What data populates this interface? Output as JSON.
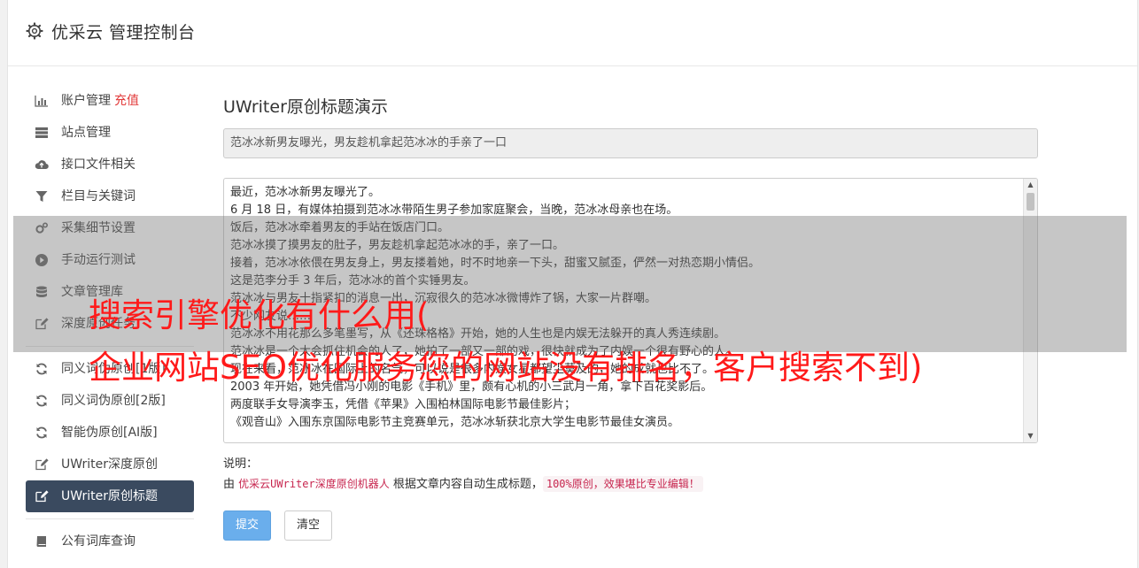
{
  "header": {
    "title": "优采云 管理控制台",
    "icon": "gear-icon"
  },
  "sidebar": {
    "items": [
      {
        "label": "账户管理",
        "accent": "充值",
        "icon": "bar-chart-icon"
      },
      {
        "label": "站点管理",
        "icon": "server-icon"
      },
      {
        "label": "接口文件相关",
        "icon": "cloud-upload-icon"
      },
      {
        "label": "栏目与关键词",
        "icon": "filter-icon"
      },
      {
        "label": "采集细节设置",
        "icon": "gears-icon"
      },
      {
        "label": "手动运行测试",
        "icon": "play-circle-icon"
      },
      {
        "label": "文章管理库",
        "icon": "database-icon"
      },
      {
        "label": "深度原创任务",
        "icon": "edit-icon"
      },
      {
        "label": "同义词伪原创[1版]",
        "icon": "refresh-icon"
      },
      {
        "label": "同义词伪原创[2版]",
        "icon": "refresh-icon"
      },
      {
        "label": "智能伪原创[AI版]",
        "icon": "refresh-icon"
      },
      {
        "label": "UWriter深度原创",
        "icon": "edit-icon"
      },
      {
        "label": "UWriter原创标题",
        "icon": "edit-icon",
        "active": true
      },
      {
        "label": "公有词库查询",
        "icon": "book-icon"
      }
    ]
  },
  "main": {
    "heading": "UWriter原创标题演示",
    "title_value": "范冰冰新男友曝光，男友趁机拿起范冰冰的手亲了一口",
    "content_lines": [
      "最近，范冰冰新男友曝光了。",
      "6 月 18 日，有媒体拍摄到范冰冰带陌生男子参加家庭聚会，当晚，范冰冰母亲也在场。",
      "饭后，范冰冰牵着男友的手站在饭店门口。",
      "范冰冰摸了摸男友的肚子，男友趁机拿起范冰冰的手，亲了一口。",
      "接着，范冰冰依偎在男友身上，男友搂着她，时不时地亲一下头，甜蜜又腻歪，俨然一对热恋期小情侣。",
      "这是范李分手 3 年后，范冰冰的首个实锤男友。",
      "范冰冰与男友十指紧扣的消息一出，沉寂很久的范冰冰微博炸了锅，大家一片群嘲。",
      "不少网友说……",
      "范冰冰不用花那么多笔墨写，从《还珠格格》开始，她的人生也是内娱无法躲开的真人秀连续剧。",
      "范冰冰是一个太会抓住机会的人了，她拍了一部又一部的戏，很快就成为了内娱一个很有野心的人。",
      "现在来看，范冰冰在国际上的名气，可以说是很多内娱女星都望尘莫及的，她的成就也比不了。",
      "2003 年开始，她凭借冯小刚的电影《手机》里，颇有心机的小三武月一角，拿下百花奖影后。",
      "两度联手女导演李玉，凭借《苹果》入围柏林国际电影节最佳影片；",
      "《观音山》入围东京国际电影节主竞赛单元，范冰冰斩获北京大学生电影节最佳女演员。"
    ],
    "note_label": "说明：",
    "note_prefix": "由 ",
    "note_brand": "优采云UWriter深度原创机器人",
    "note_middle": " 根据文章内容自动生成标题，",
    "note_tag": "100%原创，效果堪比专业编辑！",
    "submit_label": "提交",
    "clear_label": "清空"
  },
  "overlay": {
    "line1": "搜索引擎优化有什么用(",
    "line2": "企业网站SEO优化服务您的网站没有排名，客户搜索不到)"
  },
  "colors": {
    "accent": "#e23b3b",
    "active_bg": "#3a4a5f",
    "submit_bg": "#6aaeec",
    "overlay_text": "#ff1a1a"
  }
}
